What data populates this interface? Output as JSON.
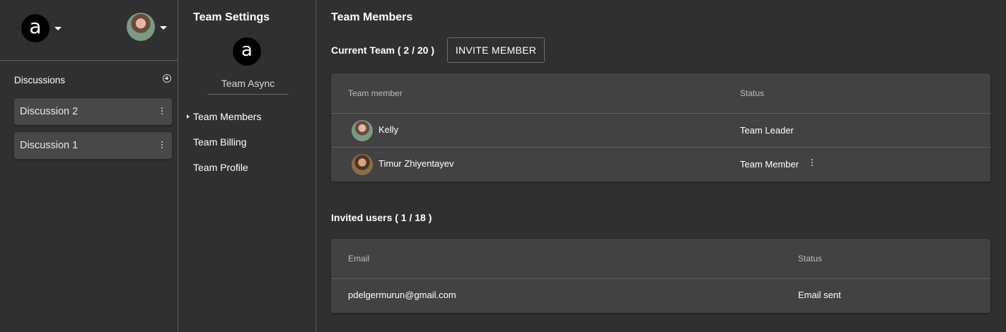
{
  "sidebar": {
    "logo_letter": "a",
    "discussions_title": "Discussions",
    "discussions": [
      {
        "label": "Discussion 2"
      },
      {
        "label": "Discussion 1"
      }
    ]
  },
  "settings": {
    "title": "Team Settings",
    "team_logo_letter": "a",
    "team_name": "Team Async",
    "nav": [
      {
        "label": "Team Members",
        "active": true
      },
      {
        "label": "Team Billing"
      },
      {
        "label": "Team Profile"
      }
    ]
  },
  "main": {
    "title": "Team Members",
    "current_team_label": "Current Team ( 2 / 20 )",
    "invite_button": "INVITE MEMBER",
    "members_table": {
      "headers": [
        "Team member",
        "Status"
      ],
      "rows": [
        {
          "name": "Kelly",
          "status": "Team Leader",
          "avatar": "kelly-avatar"
        },
        {
          "name": "Timur Zhiyentayev",
          "status": "Team Member",
          "avatar": "timur-avatar"
        }
      ]
    },
    "invited_label": "Invited users ( 1 / 18 )",
    "invited_table": {
      "headers": [
        "Email",
        "Status"
      ],
      "rows": [
        {
          "email": "pdelgermurun@gmail.com",
          "status": "Email sent"
        }
      ]
    }
  },
  "colors": {
    "background": "#303030",
    "card": "#424242",
    "discussion_item": "#484848",
    "divider": "#5d5d5d"
  }
}
